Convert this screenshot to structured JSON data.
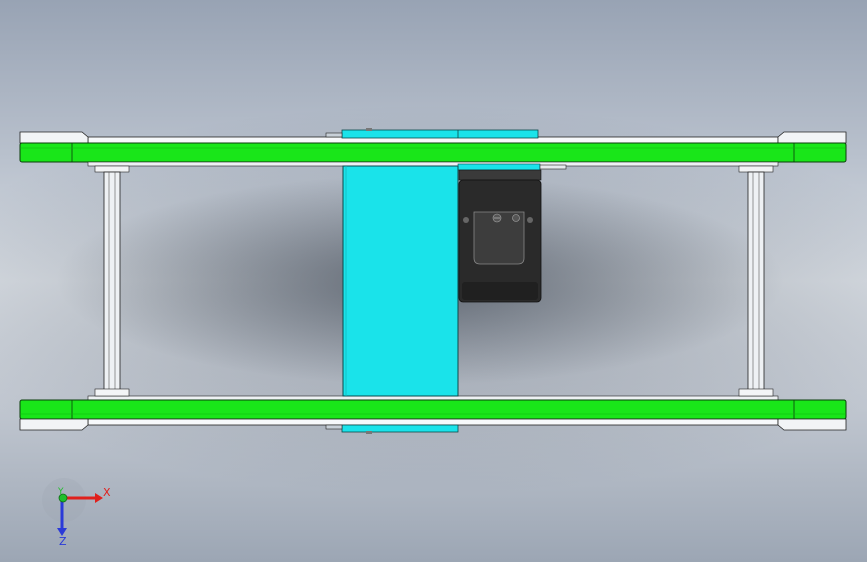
{
  "viewport": {
    "name": "cad-graphics-area"
  },
  "colors": {
    "rail_green": "#19e619",
    "block_cyan": "#1ae3ea",
    "motor_dark": "#2a2a2a",
    "frame_white": "#f4f6f8",
    "axis_x": "#e0201c",
    "axis_y": "#1fbf2a",
    "axis_z": "#2a3ad8"
  },
  "triad": {
    "x_label": "X",
    "y_label": "Y",
    "z_label": "Z"
  }
}
